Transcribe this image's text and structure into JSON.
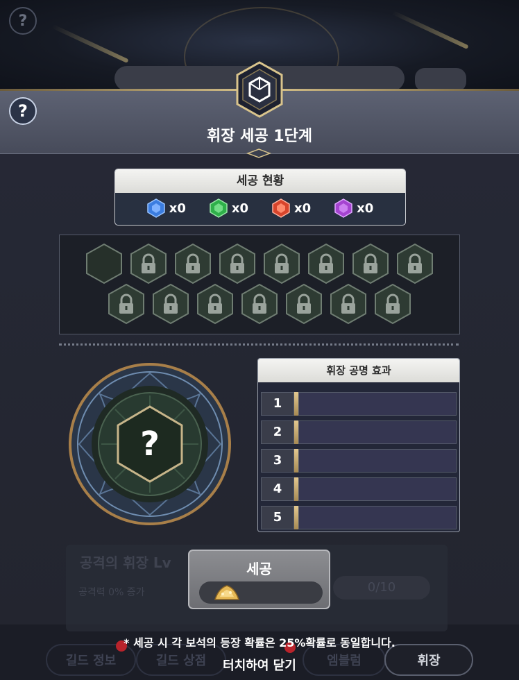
{
  "header": {
    "title": "휘장 세공 1단계",
    "help_icon": "?"
  },
  "background": {
    "help_icon": "?"
  },
  "status": {
    "title": "세공 현황",
    "gems": [
      {
        "name": "blue-gem-icon",
        "color": "#3b7de0",
        "count": "x0"
      },
      {
        "name": "green-gem-icon",
        "color": "#2fb04a",
        "count": "x0"
      },
      {
        "name": "red-gem-icon",
        "color": "#d8452c",
        "count": "x0"
      },
      {
        "name": "purple-gem-icon",
        "color": "#a544d0",
        "count": "x0"
      }
    ]
  },
  "slots": {
    "total": 15,
    "unlocked": 1,
    "locked_icon": "lock-icon"
  },
  "emblem": {
    "unknown_mark": "?"
  },
  "effect": {
    "title": "휘장 공명 효과",
    "rows": [
      {
        "num": "1"
      },
      {
        "num": "2"
      },
      {
        "num": "3"
      },
      {
        "num": "4"
      },
      {
        "num": "5"
      }
    ]
  },
  "refine_button": {
    "label": "세공",
    "cost_icon": "gold-pile-icon"
  },
  "footer": {
    "note": "* 세공 시 각 보석의 등장 확률은 25%확률로 동일합니다.",
    "close": "터치하여 닫기"
  },
  "bottom_nav": [
    "길드 정보",
    "길드 상점",
    "",
    "엠블럼",
    "휘장"
  ],
  "bg_card": {
    "title": "공격의 휘장 Lv",
    "desc": "공격력 0% 증가",
    "progress": "0/10"
  },
  "colors": {
    "accent_gold": "#d9c48c",
    "panel": "#262936"
  }
}
